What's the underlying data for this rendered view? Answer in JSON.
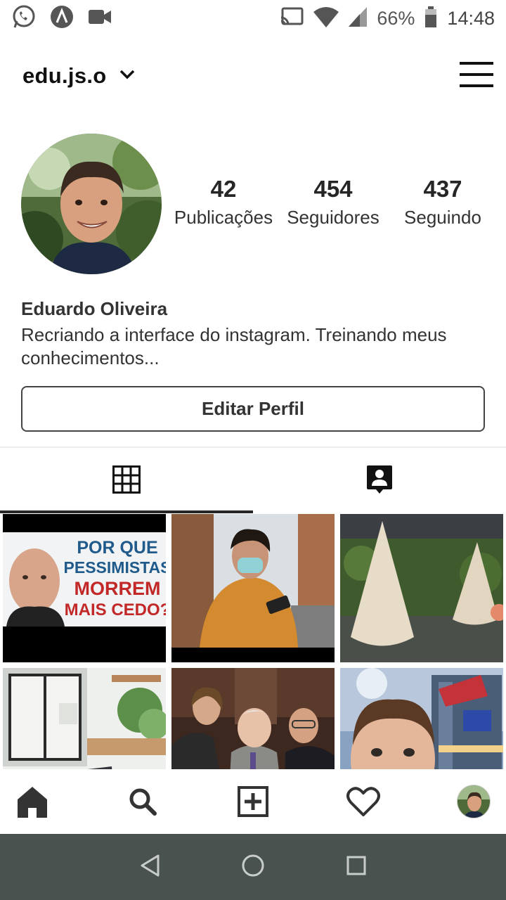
{
  "status_bar": {
    "battery": "66%",
    "time": "14:48",
    "left_icons": [
      "whatsapp-icon",
      "app-icon",
      "video-camera-icon"
    ],
    "right_icons": [
      "cast-icon",
      "wifi-icon",
      "signal-icon",
      "battery-icon"
    ]
  },
  "header": {
    "username": "edu.js.o",
    "menu_icon": "hamburger-menu-icon"
  },
  "profile": {
    "stats": [
      {
        "value": "42",
        "label": "Publicações"
      },
      {
        "value": "454",
        "label": "Seguidores"
      },
      {
        "value": "437",
        "label": "Seguindo"
      }
    ],
    "name": "Eduardo Oliveira",
    "bio": "Recriando a interface do instagram. Treinando meus conhecimentos...",
    "edit_button": "Editar Perfil"
  },
  "tabs": [
    {
      "icon": "grid-icon",
      "active": true
    },
    {
      "icon": "tagged-person-icon",
      "active": false
    }
  ],
  "posts": [
    {
      "title": "POR QUE PESSIMISTAS MORREM MAIS CEDO?",
      "lines": [
        "POR QUE",
        "PESSIMISTAS",
        "MORREM",
        "MAIS CEDO?"
      ]
    },
    {
      "title": ""
    },
    {
      "title": ""
    },
    {
      "title": ""
    },
    {
      "title": ""
    },
    {
      "title": ""
    }
  ],
  "bottom_nav": [
    "home-icon",
    "search-icon",
    "add-post-icon",
    "heart-icon",
    "profile-avatar"
  ],
  "android_nav": [
    "back-icon",
    "home-circle-icon",
    "recents-icon"
  ]
}
